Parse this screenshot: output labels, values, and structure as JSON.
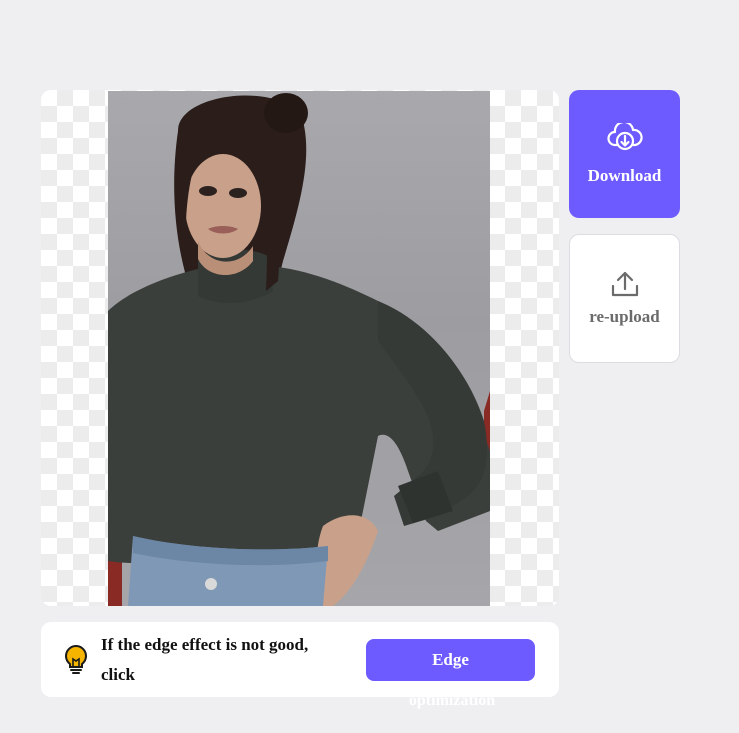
{
  "editor": {
    "image_alt": "Woman in dark turtleneck sweater with background removed"
  },
  "actions": {
    "download_label": "Download",
    "download_icon": "cloud-download-icon",
    "reupload_label": "re-upload",
    "reupload_icon": "upload-icon"
  },
  "tip": {
    "icon": "lightbulb-icon",
    "text": "If the edge effect is not good, click",
    "button_label_line1": "Edge",
    "button_label_line2": "optimization"
  },
  "colors": {
    "accent": "#6e5bff",
    "background": "#efeff2",
    "bulb": "#f5b400"
  }
}
